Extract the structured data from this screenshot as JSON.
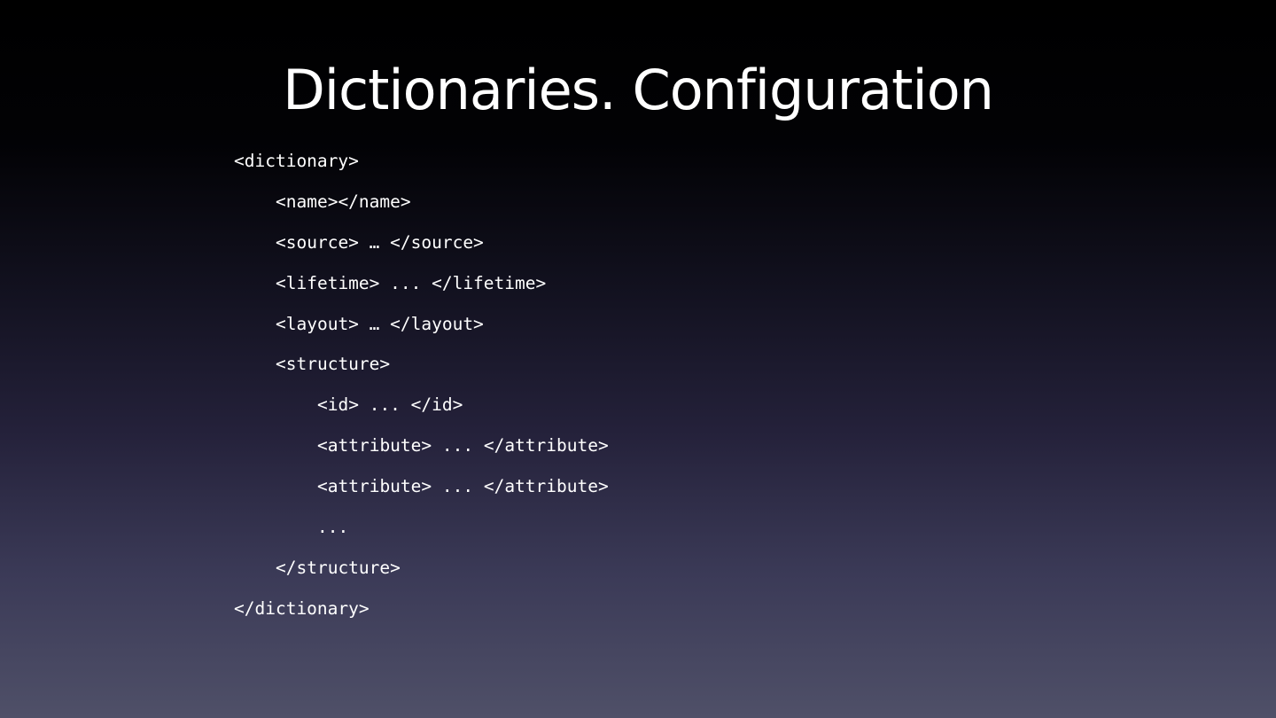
{
  "slide": {
    "title": "Dictionaries. Configuration",
    "code_lines": [
      {
        "text": "<dictionary>",
        "indent": 0
      },
      {
        "text": "<name></name>",
        "indent": 1
      },
      {
        "text": "<source> … </source>",
        "indent": 1
      },
      {
        "text": "<lifetime> ... </lifetime>",
        "indent": 1
      },
      {
        "text": "<layout> … </layout>",
        "indent": 1
      },
      {
        "text": "<structure>",
        "indent": 1
      },
      {
        "text": "<id> ... </id>",
        "indent": 2
      },
      {
        "text": "<attribute> ... </attribute>",
        "indent": 2
      },
      {
        "text": "<attribute> ... </attribute>",
        "indent": 2
      },
      {
        "text": "...",
        "indent": 2
      },
      {
        "text": "</structure>",
        "indent": 1
      },
      {
        "text": "</dictionary>",
        "indent": 0
      }
    ]
  }
}
